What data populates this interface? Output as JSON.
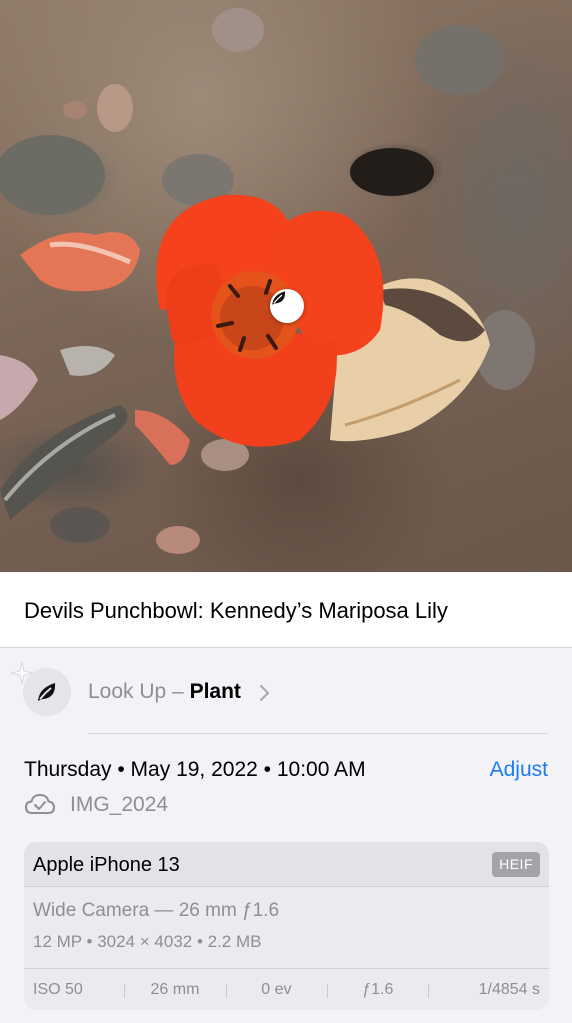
{
  "caption": "Devils Punchbowl: Kennedy’s Mariposa Lily",
  "lookup": {
    "prefix": "Look Up – ",
    "subject": "Plant",
    "icon": "leaf-icon"
  },
  "info": {
    "date": "Thursday • May 19, 2022 • 10:00 AM",
    "adjust_label": "Adjust",
    "file_name": "IMG_2024",
    "file_icon": "icloud-check-icon"
  },
  "camera": {
    "device": "Apple iPhone 13",
    "format_badge": "HEIF",
    "lens": "Wide Camera — 26 mm ƒ1.6",
    "specs": "12 MP  •  3024 × 4032  •  2.2 MB",
    "exif": [
      "ISO 50",
      "26 mm",
      "0 ev",
      "ƒ1.6",
      "1/4854 s"
    ]
  },
  "colors": {
    "accent": "#1a7cf5",
    "flower": "#f5411c",
    "secondary_text": "#8e8e93",
    "background": "#f2f2f7"
  }
}
